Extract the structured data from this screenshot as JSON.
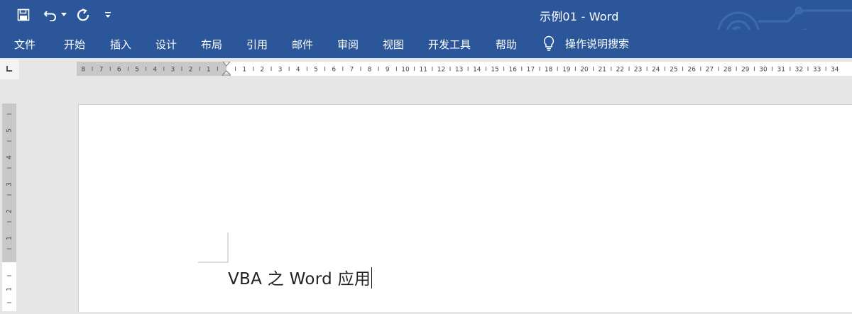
{
  "window": {
    "title": "示例01 - Word"
  },
  "quick_access": {
    "save_icon": "save-icon",
    "undo_icon": "undo-icon",
    "undo_dropdown_icon": "chevron-down-icon",
    "redo_icon": "redo-icon",
    "customize_icon": "customize-qat-icon"
  },
  "ribbon": {
    "tabs": [
      {
        "label": "文件"
      },
      {
        "label": "开始"
      },
      {
        "label": "插入"
      },
      {
        "label": "设计"
      },
      {
        "label": "布局"
      },
      {
        "label": "引用"
      },
      {
        "label": "邮件"
      },
      {
        "label": "审阅"
      },
      {
        "label": "视图"
      },
      {
        "label": "开发工具"
      },
      {
        "label": "帮助"
      }
    ],
    "tell_me": {
      "icon": "lightbulb-icon",
      "label": "操作说明搜索"
    }
  },
  "ruler": {
    "horizontal_left_labels": [
      "8",
      "7",
      "6",
      "5",
      "4",
      "3",
      "2",
      "1"
    ],
    "horizontal_right_labels": [
      "1",
      "2",
      "3",
      "4",
      "5",
      "6",
      "7",
      "8",
      "9",
      "10",
      "11",
      "12",
      "13",
      "14",
      "15",
      "16",
      "17",
      "18",
      "19",
      "20",
      "21",
      "22",
      "23",
      "24",
      "25",
      "26",
      "27",
      "28",
      "29",
      "30",
      "31",
      "32",
      "33",
      "34"
    ],
    "vertical_top_labels": [
      "5",
      "4",
      "3",
      "2",
      "1"
    ],
    "vertical_bottom_labels": [
      "1"
    ]
  },
  "document": {
    "text": "VBA 之 Word 应用"
  },
  "colors": {
    "brand": "#2b579a",
    "workspace": "#e6e6e6",
    "ruler_margin": "#c8c8c8"
  }
}
